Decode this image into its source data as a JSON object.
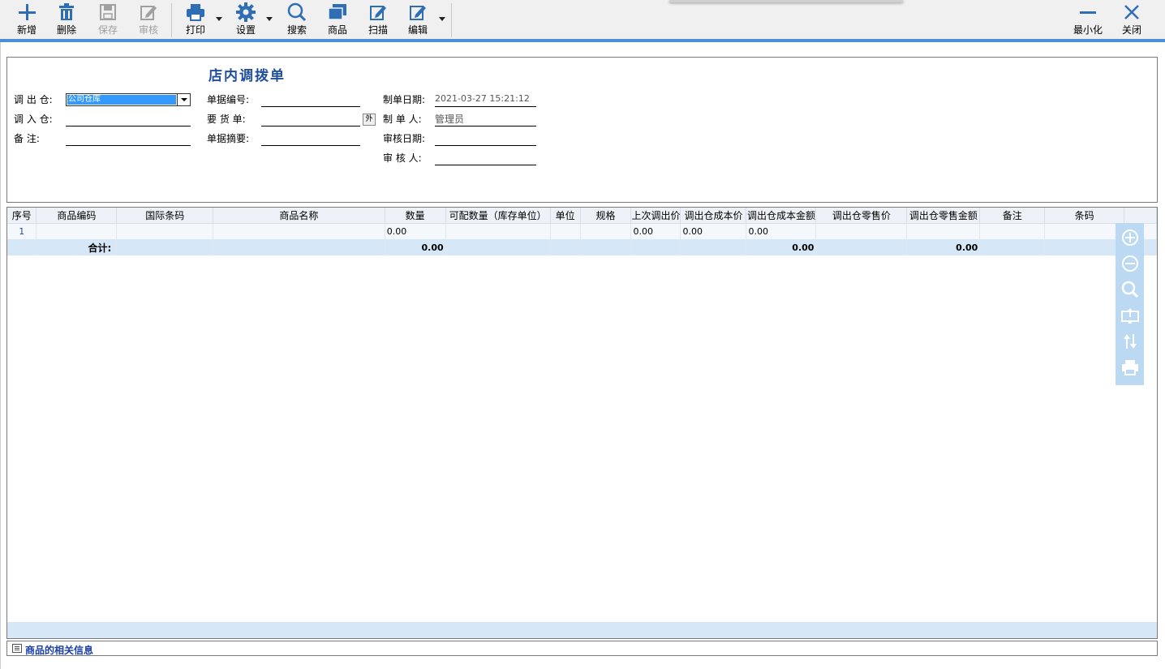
{
  "toolbar": {
    "new": "新增",
    "delete": "删除",
    "save": "保存",
    "audit": "审核",
    "print": "打印",
    "settings": "设置",
    "search": "搜索",
    "goods": "商品",
    "scan": "扫描",
    "edit": "编辑",
    "minimize": "最小化",
    "close": "关闭"
  },
  "form": {
    "title": "店内调拨单",
    "out_warehouse_label": "调 出 仓:",
    "out_warehouse_value": "公司仓库",
    "in_warehouse_label": "调 入 仓:",
    "remark_label": "备    注:",
    "doc_no_label": "单据编号:",
    "request_label": "要 货 单:",
    "summary_label": "单据摘要:",
    "create_date_label": "制单日期:",
    "create_date_value": "2021-03-27 15:21:12",
    "creator_label": "制 单 人:",
    "creator_value": "管理员",
    "audit_date_label": "审核日期:",
    "auditor_label": "审 核 人:",
    "pick_label": "外"
  },
  "grid": {
    "columns": [
      "序号",
      "商品编码",
      "国际条码",
      "商品名称",
      "数量",
      "可配数量（库存单位）",
      "单位",
      "规格",
      "上次调出价",
      "调出仓成本价",
      "调出仓成本金额",
      "调出仓零售价",
      "调出仓零售金额",
      "备注",
      "条码"
    ],
    "row1": {
      "seq": "1",
      "qty": "0.00",
      "last_price": "0.00",
      "cost_price": "0.00",
      "cost_amount": "0.00"
    },
    "total": {
      "label": "合计:",
      "qty": "0.00",
      "cost_amount": "0.00",
      "retail_amount": "0.00"
    }
  },
  "status": {
    "text": "商品的相关信息"
  },
  "colors": {
    "accent": "#4a90d9",
    "title": "#1f4e9c",
    "icon": "#2f6db5"
  }
}
